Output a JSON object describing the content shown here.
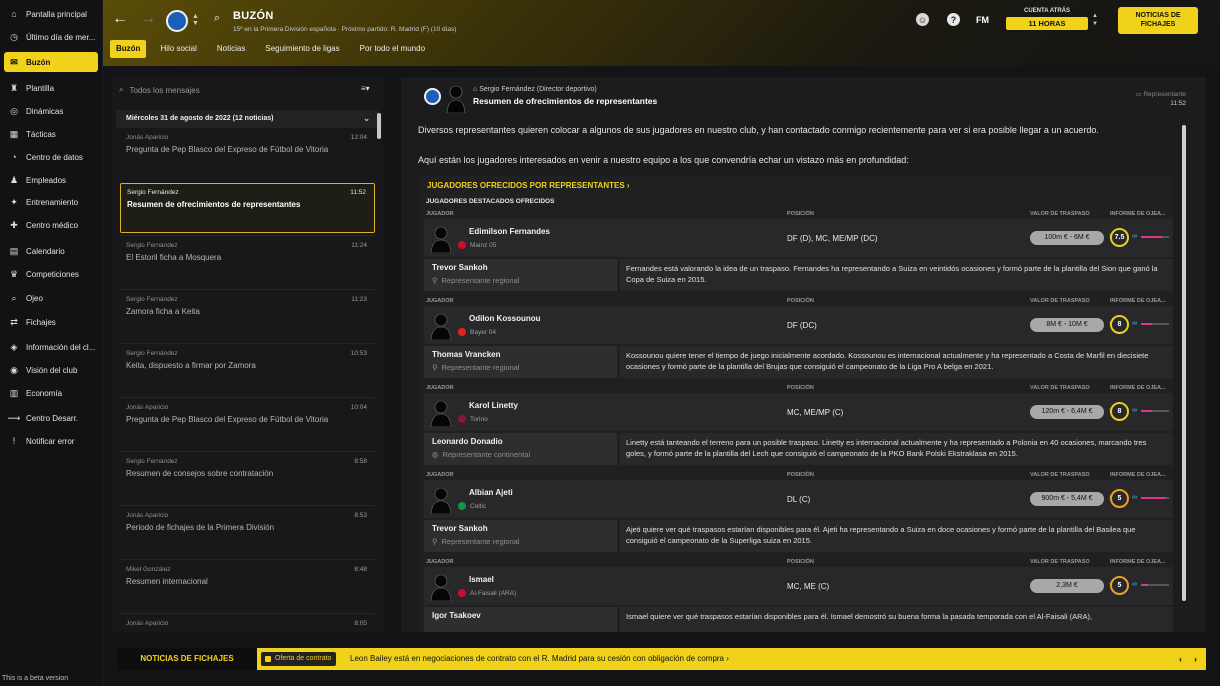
{
  "colors": {
    "accent": "#f0d21b",
    "background": "#141416",
    "panel": "#1c1c1e"
  },
  "sidebar": {
    "items": [
      {
        "label": "Pantalla principal",
        "icon": "home-icon",
        "glyph": "⌂"
      },
      {
        "label": "Último día de mer...",
        "icon": "clock-icon",
        "glyph": "◷"
      },
      {
        "label": "Buzón",
        "icon": "mail-icon",
        "glyph": "✉"
      },
      {
        "label": "Plantilla",
        "icon": "shirt-icon",
        "glyph": "♜"
      },
      {
        "label": "Dinámicas",
        "icon": "dynamics-icon",
        "glyph": "◎"
      },
      {
        "label": "Tácticas",
        "icon": "tactics-icon",
        "glyph": "▦"
      },
      {
        "label": "Centro de datos",
        "icon": "data-icon",
        "glyph": "◔"
      },
      {
        "label": "Empleados",
        "icon": "staff-icon",
        "glyph": "♟"
      },
      {
        "label": "Entrenamiento",
        "icon": "training-icon",
        "glyph": "✦"
      },
      {
        "label": "Centro médico",
        "icon": "medical-icon",
        "glyph": "✚"
      },
      {
        "label": "Calendario",
        "icon": "calendar-icon",
        "glyph": "▤"
      },
      {
        "label": "Competiciones",
        "icon": "trophy-icon",
        "glyph": "♛"
      },
      {
        "label": "Ojeo",
        "icon": "scouting-icon",
        "glyph": "⌕"
      },
      {
        "label": "Fichajes",
        "icon": "transfers-icon",
        "glyph": "⇄"
      },
      {
        "label": "Información del cl...",
        "icon": "club-info-icon",
        "glyph": "◈"
      },
      {
        "label": "Visión del club",
        "icon": "club-vision-icon",
        "glyph": "◉"
      },
      {
        "label": "Economía",
        "icon": "finance-icon",
        "glyph": "▥"
      },
      {
        "label": "Centro Desarr.",
        "icon": "development-icon",
        "glyph": "⟿"
      },
      {
        "label": "Notificar error",
        "icon": "report-bug-icon",
        "glyph": "!"
      }
    ],
    "beta_text": "This is a beta version"
  },
  "header": {
    "title": "BUZÓN",
    "subtitle": "15º en la Primera División española · Próximo partido: R. Madrid (F) (10 días)",
    "countdown_label": "CUENTA ATRÁS",
    "countdown_value": "11 HORAS",
    "news_button": "NOTICIAS DE FICHAJES",
    "fm_logo": "FM"
  },
  "tabs": [
    "Buzón",
    "Hilo social",
    "Noticias",
    "Seguimiento de ligas",
    "Por todo el mundo"
  ],
  "inbox": {
    "search_placeholder": "Todos los mensajes",
    "date_header": "Miércoles 31 de agosto de 2022 (12 noticias)",
    "messages": [
      {
        "from": "Jonás Aparicio",
        "time": "12:04",
        "subject": "Pregunta de Pep Blasco del Expreso de Fútbol de Vitoria"
      },
      {
        "from": "Sergio Fernández",
        "time": "11:52",
        "subject": "Resumen de ofrecimientos de representantes"
      },
      {
        "from": "Sergio Fernández",
        "time": "11:24",
        "subject": "El Estoril ficha a Mosquera"
      },
      {
        "from": "Sergio Fernández",
        "time": "11:23",
        "subject": "Zamora ficha a Keita"
      },
      {
        "from": "Sergio Fernández",
        "time": "10:53",
        "subject": "Keita, dispuesto a firmar por Zamora"
      },
      {
        "from": "Jonás Aparicio",
        "time": "10:04",
        "subject": "Pregunta de Pep Blasco del Expreso de Fútbol de Vitoria"
      },
      {
        "from": "Sergio Fernández",
        "time": "8:58",
        "subject": "Resumen de consejos sobre contratación"
      },
      {
        "from": "Jonás Aparicio",
        "time": "8:53",
        "subject": "Periodo de fichajes de la Primera División"
      },
      {
        "from": "Mikel González",
        "time": "8:48",
        "subject": "Resumen internacional"
      },
      {
        "from": "Jonás Aparicio",
        "time": "8:05",
        "subject": ""
      }
    ]
  },
  "message": {
    "sender": "Sergio Fernández (Director deportivo)",
    "subject": "Resumen de ofrecimientos de representantes",
    "tag": "Representante",
    "time": "11:52",
    "para1": "Diversos representantes quieren colocar a algunos de sus jugadores en nuestro club, y han contactado conmigo recientemente para ver si era posible llegar a un acuerdo.",
    "para2": "Aquí están los jugadores interesados en venir a nuestro equipo a los que convendría echar un vistazo más en profundidad:",
    "offers_title": "JUGADORES OFRECIDOS POR REPRESENTANTES ›",
    "offers_subtitle": "JUGADORES DESTACADOS OFRECIDOS",
    "col_player": "JUGADOR",
    "col_position": "POSICIÓN",
    "col_value": "VALOR DE TRASPASO",
    "col_report": "INFORME DE OJEA...",
    "players": [
      {
        "name": "Edimilson Fernandes",
        "club": "Mainz 05",
        "club_color": "#c8102e",
        "position": "DF (D), MC, ME/MP (DC)",
        "value": "100m € - 6M €",
        "rating": "7.5",
        "rating_level": 0.75,
        "ring": "yellow",
        "agent": "Trevor Sankoh",
        "agent_role": "Representante regional",
        "desc": "Fernandes está valorando la idea de un traspaso. Fernandes ha representando a Suiza en veintidós ocasiones y formó parte de la plantilla del Sion que ganó la Copa de Suiza en 2015."
      },
      {
        "name": "Odilon Kossounou",
        "club": "Bayer 04",
        "club_color": "#e32219",
        "position": "DF (DC)",
        "value": "8M € - 10M €",
        "rating": "8",
        "rating_level": 0.4,
        "ring": "yellow",
        "agent": "Thomas Vrancken",
        "agent_role": "Representante regional",
        "desc": "Kossounou quiere tener el tiempo de juego inicialmente acordado. Kossounou es internacional actualmente y ha representado a Costa de Marfil en diecisiete ocasiones y formó parte de la plantilla del Brujas que consiguió el campeonato de la Liga Pro A belga en 2021."
      },
      {
        "name": "Karol Linetty",
        "club": "Torino",
        "club_color": "#8a1538",
        "position": "MC, ME/MP (C)",
        "value": "120m € - 6,4M €",
        "rating": "8",
        "rating_level": 0.4,
        "ring": "yellow",
        "agent": "Leonardo Donadio",
        "agent_role": "Representante continental",
        "desc": "Linetty está tanteando el terreno para un posible traspaso. Linetty es internacional actualmente y ha representado a Polonia en 40 ocasiones, marcando tres goles, y formó parte de la plantilla del Lech que consiguió el campeonato de la PKO Bank Polski Ekstraklasa en 2015."
      },
      {
        "name": "Albian Ajeti",
        "club": "Celtic",
        "club_color": "#16924a",
        "position": "DL (C)",
        "value": "900m € - 5,4M €",
        "rating": "5",
        "rating_level": 0.9,
        "ring": "orange",
        "agent": "Trevor Sankoh",
        "agent_role": "Representante regional",
        "desc": "Ajeti quiere ver qué traspasos estarían disponibles para él. Ajeti ha representando a Suiza en doce ocasiones y formó parte de la plantilla del Basilea que consiguió el campeonato de la Superliga suiza en 2015."
      },
      {
        "name": "Ismael",
        "club": "Al-Faisali (ARA)",
        "club_color": "#c8102e",
        "position": "MC, ME (C)",
        "value": "2,3M €",
        "rating": "5",
        "rating_level": 0.25,
        "ring": "orange",
        "agent": "Igor Tsakoev",
        "agent_role": "",
        "desc": "Ismael quiere ver qué traspasos estarían disponibles para él. Ismael demostró su buena forma la pasada temporada con el Al-Faisali (ARA),"
      }
    ]
  },
  "ticker": {
    "label": "NOTICIAS DE FICHAJES",
    "chip": "Oferta de contrato",
    "text": "Leon Bailey está en negociaciones de contrato con el R. Madrid para su cesión con obligación de compra ›"
  }
}
